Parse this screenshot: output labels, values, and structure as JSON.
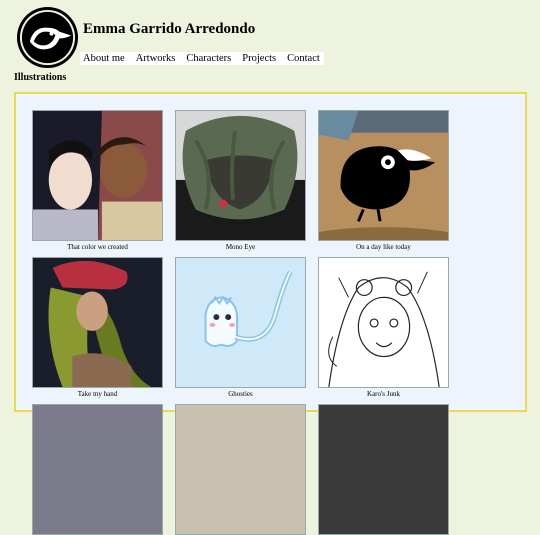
{
  "site": {
    "title": "Emma Garrido Arredondo",
    "logo_icon": "crow-logo-icon"
  },
  "nav": {
    "items": [
      {
        "label": "About me"
      },
      {
        "label": "Artworks"
      },
      {
        "label": "Characters"
      },
      {
        "label": "Projects"
      },
      {
        "label": "Contact"
      }
    ]
  },
  "section": {
    "heading": "Illustrations"
  },
  "gallery": {
    "items": [
      {
        "caption": "That color we created"
      },
      {
        "caption": "Mono Eye"
      },
      {
        "caption": "On a day like today"
      },
      {
        "caption": "Take my hand"
      },
      {
        "caption": "Ghosties"
      },
      {
        "caption": "Karo's Junk"
      }
    ]
  },
  "colors": {
    "page_background": "#eef3dd",
    "nav_background": "#ffffff",
    "gallery_border": "#e8da55",
    "gallery_background": "#eef4fb"
  }
}
